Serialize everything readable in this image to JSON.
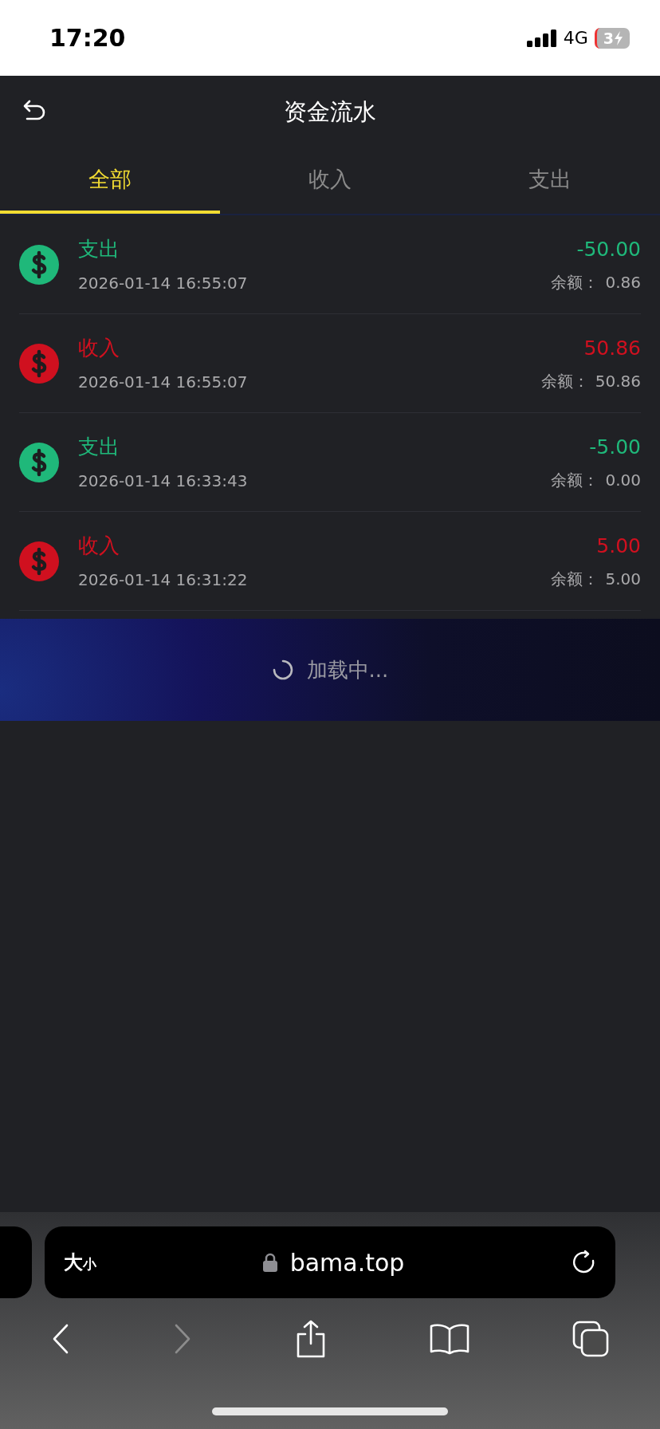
{
  "status_bar": {
    "time": "17:20",
    "network": "4G",
    "battery": "3"
  },
  "header": {
    "title": "资金流水"
  },
  "tabs": [
    {
      "label": "全部",
      "selected": true
    },
    {
      "label": "收入",
      "selected": false
    },
    {
      "label": "支出",
      "selected": false
    }
  ],
  "transactions": [
    {
      "kind": "expense",
      "type": "支出",
      "time": "2026-01-14 16:55:07",
      "amount": "-50.00",
      "balance_label": "余额：",
      "balance": "0.86"
    },
    {
      "kind": "income",
      "type": "收入",
      "time": "2026-01-14 16:55:07",
      "amount": "50.86",
      "balance_label": "余额：",
      "balance": "50.86"
    },
    {
      "kind": "expense",
      "type": "支出",
      "time": "2026-01-14 16:33:43",
      "amount": "-5.00",
      "balance_label": "余额：",
      "balance": "0.00"
    },
    {
      "kind": "income",
      "type": "收入",
      "time": "2026-01-14 16:31:22",
      "amount": "5.00",
      "balance_label": "余额：",
      "balance": "5.00"
    }
  ],
  "loading": {
    "text": "加载中..."
  },
  "browser": {
    "text_size_large": "大",
    "text_size_small": "小",
    "url": "bama.top"
  }
}
